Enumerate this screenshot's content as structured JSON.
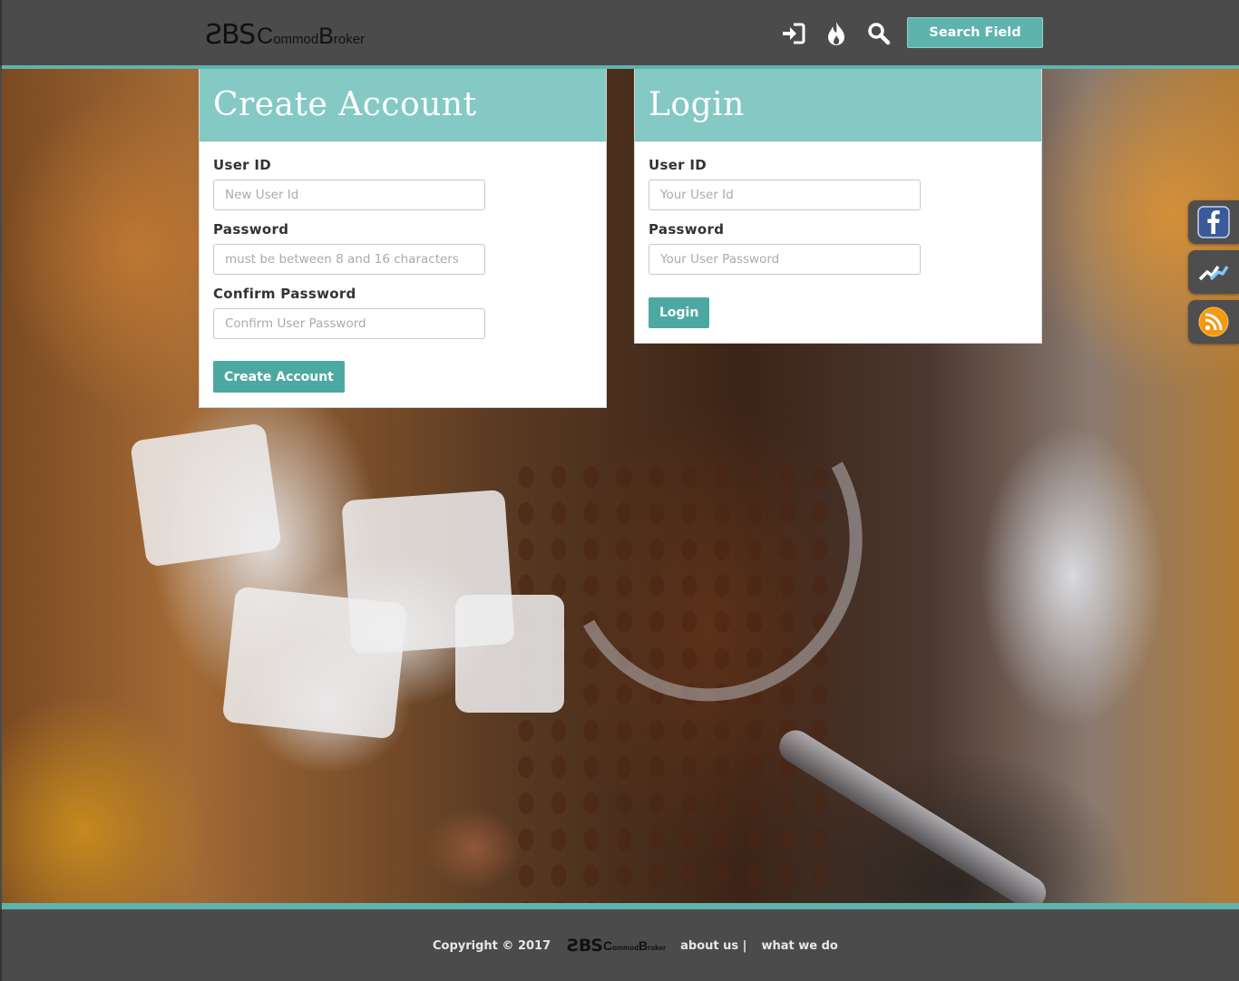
{
  "header": {
    "logo_mark": "ƧBS",
    "logo_word_c": "C",
    "logo_word_1": "ommod",
    "logo_word_b": "B",
    "logo_word_2": "roker",
    "search_label": "Search Field",
    "icons": [
      "sign-in-icon",
      "fire-icon",
      "search-icon"
    ]
  },
  "create_account": {
    "title": "Create Account",
    "user_id_label": "User ID",
    "user_id_placeholder": "New User Id",
    "password_label": "Password",
    "password_placeholder": "must be between 8 and 16 characters",
    "confirm_label": "Confirm Password",
    "confirm_placeholder": "Confirm User Password",
    "submit_label": "Create Account"
  },
  "login": {
    "title": "Login",
    "user_id_label": "User ID",
    "user_id_placeholder": "Your User Id",
    "password_label": "Password",
    "password_placeholder": "Your User Password",
    "submit_label": "Login"
  },
  "social": [
    "facebook-icon",
    "chart-icon",
    "rss-icon"
  ],
  "footer": {
    "copyright": "Copyright © 2017",
    "about": "about us |",
    "what": "what we do"
  },
  "colors": {
    "accent": "#5fb3ad",
    "panel_header": "#84c9c4",
    "bar": "#4b4b4b",
    "button": "#4ea8a2"
  }
}
